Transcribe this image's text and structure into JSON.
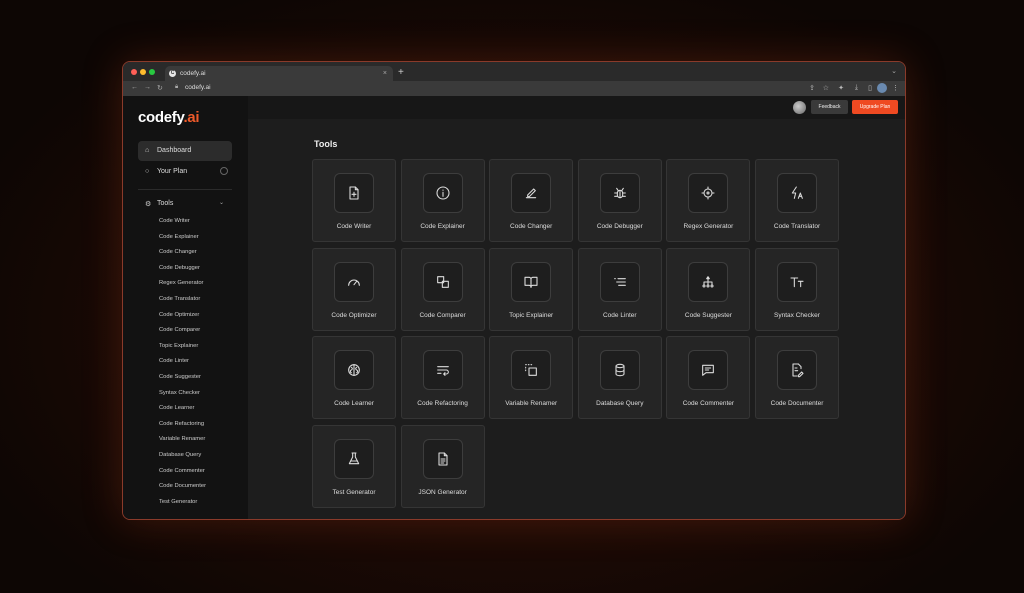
{
  "browser": {
    "tab_title": "codefy.ai",
    "tab_favicon": "C",
    "tab_close": "×",
    "new_tab": "+",
    "url": "codefy.ai"
  },
  "colors": {
    "accent": "#ef4a22",
    "brand_ai": "#ef5a2a",
    "background": "#1d1d1d"
  },
  "sidebar": {
    "logo_main": "codefy",
    "logo_ai": ".ai",
    "nav": [
      {
        "label": "Dashboard",
        "icon": "home-icon"
      },
      {
        "label": "Your Plan",
        "icon": "plan-icon"
      }
    ],
    "tools_section": {
      "label": "Tools",
      "icon": "tools-icon"
    },
    "tools": [
      "Code Writer",
      "Code Explainer",
      "Code Changer",
      "Code Debugger",
      "Regex Generator",
      "Code Translator",
      "Code Optimizer",
      "Code Comparer",
      "Topic Explainer",
      "Code Linter",
      "Code Suggester",
      "Syntax Checker",
      "Code Learner",
      "Code Refactoring",
      "Variable Renamer",
      "Database Query",
      "Code Commenter",
      "Code Documenter",
      "Test Generator"
    ]
  },
  "header": {
    "feedback_label": "Feedback",
    "upgrade_label": "Upgrade Plan"
  },
  "main": {
    "title": "Tools",
    "cards": [
      {
        "label": "Code Writer",
        "icon": "file-plus-icon"
      },
      {
        "label": "Code Explainer",
        "icon": "info-icon"
      },
      {
        "label": "Code Changer",
        "icon": "pencil-icon"
      },
      {
        "label": "Code Debugger",
        "icon": "bug-icon"
      },
      {
        "label": "Regex Generator",
        "icon": "target-icon"
      },
      {
        "label": "Code Translator",
        "icon": "translate-icon"
      },
      {
        "label": "Code Optimizer",
        "icon": "gauge-icon"
      },
      {
        "label": "Code Comparer",
        "icon": "compare-icon"
      },
      {
        "label": "Topic Explainer",
        "icon": "book-icon"
      },
      {
        "label": "Code Linter",
        "icon": "list-icon"
      },
      {
        "label": "Code Suggester",
        "icon": "hierarchy-icon"
      },
      {
        "label": "Syntax Checker",
        "icon": "text-size-icon"
      },
      {
        "label": "Code Learner",
        "icon": "brain-icon"
      },
      {
        "label": "Code Refactoring",
        "icon": "wrap-text-icon"
      },
      {
        "label": "Variable Renamer",
        "icon": "select-icon"
      },
      {
        "label": "Database Query",
        "icon": "database-icon"
      },
      {
        "label": "Code Commenter",
        "icon": "comment-icon"
      },
      {
        "label": "Code Documenter",
        "icon": "document-edit-icon"
      },
      {
        "label": "Test Generator",
        "icon": "flask-icon"
      },
      {
        "label": "JSON Generator",
        "icon": "file-text-icon"
      }
    ]
  }
}
